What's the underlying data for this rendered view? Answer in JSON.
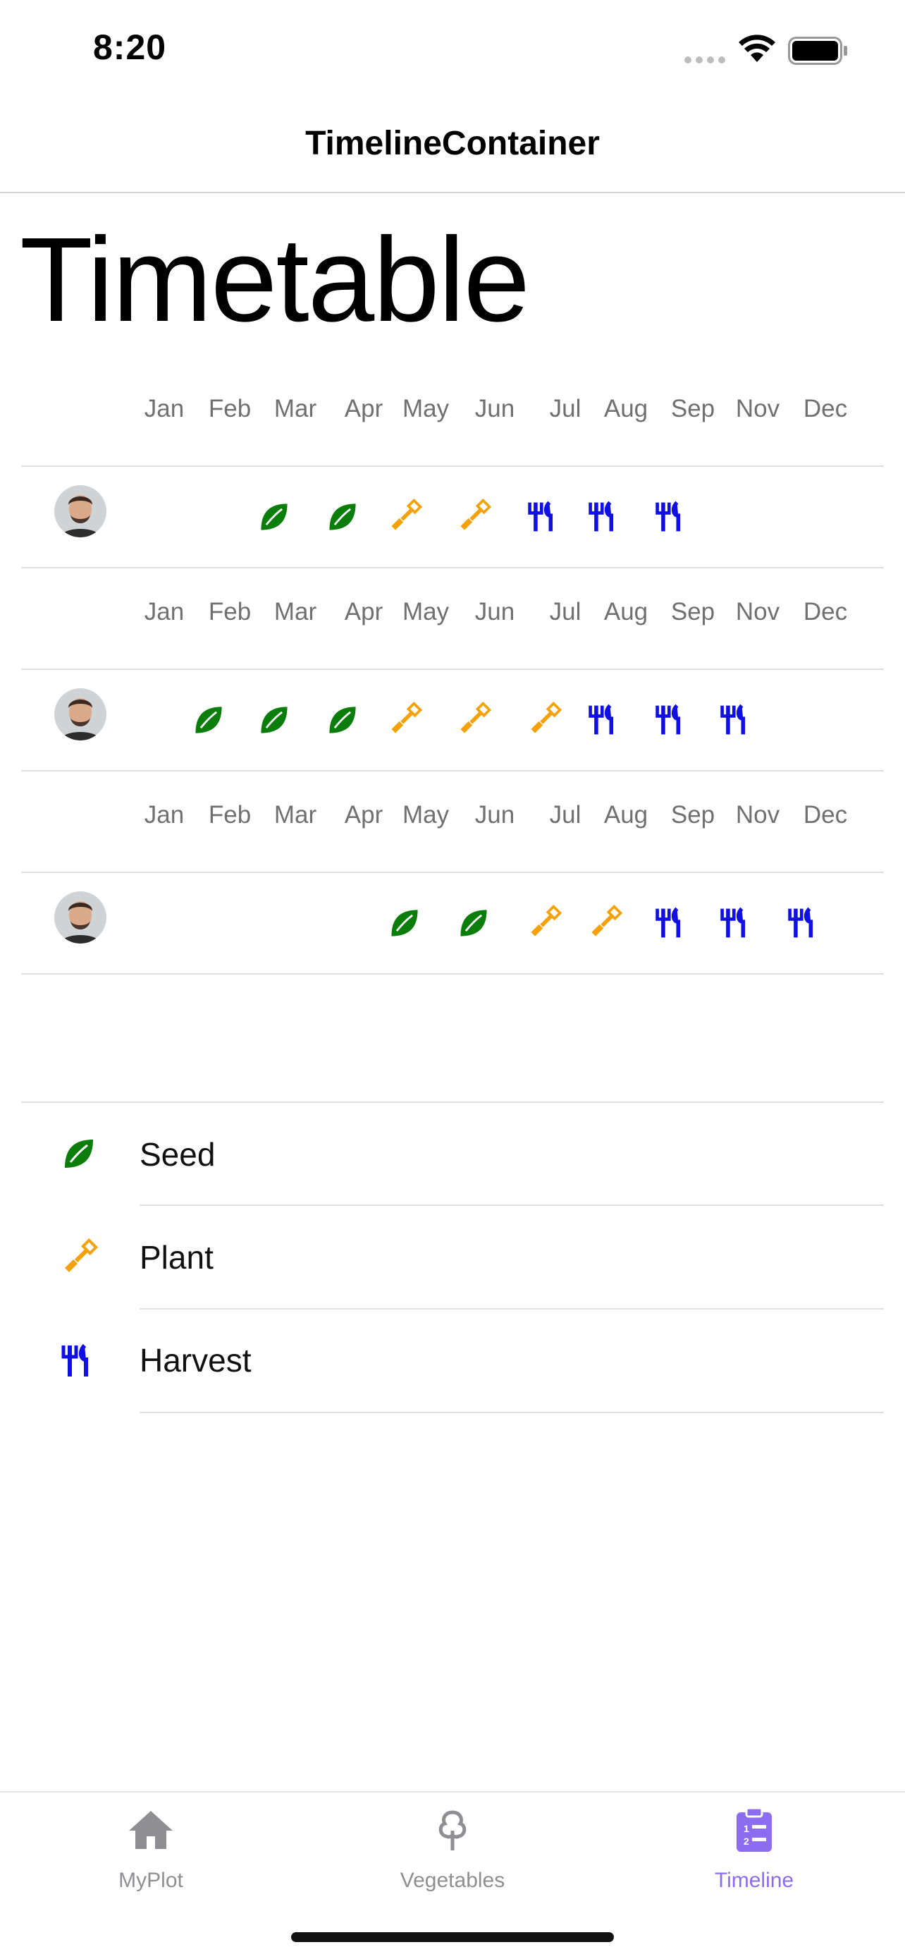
{
  "status_bar": {
    "time": "8:20"
  },
  "nav": {
    "title": "TimelineContainer"
  },
  "page": {
    "title": "Timetable"
  },
  "months": [
    "Jan",
    "Feb",
    "Mar",
    "Apr",
    "May",
    "Jun",
    "Jul",
    "Aug",
    "Sep",
    "Nov",
    "Dec"
  ],
  "rows": [
    {
      "avatar": "avatar",
      "schedule": [
        null,
        null,
        "seed",
        "seed",
        "plant",
        "plant",
        "harvest",
        "harvest",
        "harvest",
        null,
        null
      ]
    },
    {
      "avatar": "avatar",
      "schedule": [
        null,
        "seed",
        "seed",
        "seed",
        "plant",
        "plant",
        "plant",
        "harvest",
        "harvest",
        "harvest",
        null
      ]
    },
    {
      "avatar": "avatar",
      "schedule": [
        null,
        null,
        null,
        null,
        "seed",
        "seed",
        "plant",
        "plant",
        "harvest",
        "harvest",
        "harvest"
      ]
    }
  ],
  "legend": [
    {
      "key": "seed",
      "label": "Seed",
      "icon": "leaf-icon"
    },
    {
      "key": "plant",
      "label": "Plant",
      "icon": "shovel-icon"
    },
    {
      "key": "harvest",
      "label": "Harvest",
      "icon": "fork-knife-icon"
    }
  ],
  "colors": {
    "seed": "#0a7d0a",
    "plant": "#f5a10a",
    "harvest": "#1010e0",
    "tab_active": "#8c6cf0",
    "tab_inactive": "#8e8e93"
  },
  "tabs": [
    {
      "label": "MyPlot",
      "icon": "house-icon",
      "active": false
    },
    {
      "label": "Vegetables",
      "icon": "tree-icon",
      "active": false
    },
    {
      "label": "Timeline",
      "icon": "clipboard-list-icon",
      "active": true
    }
  ]
}
